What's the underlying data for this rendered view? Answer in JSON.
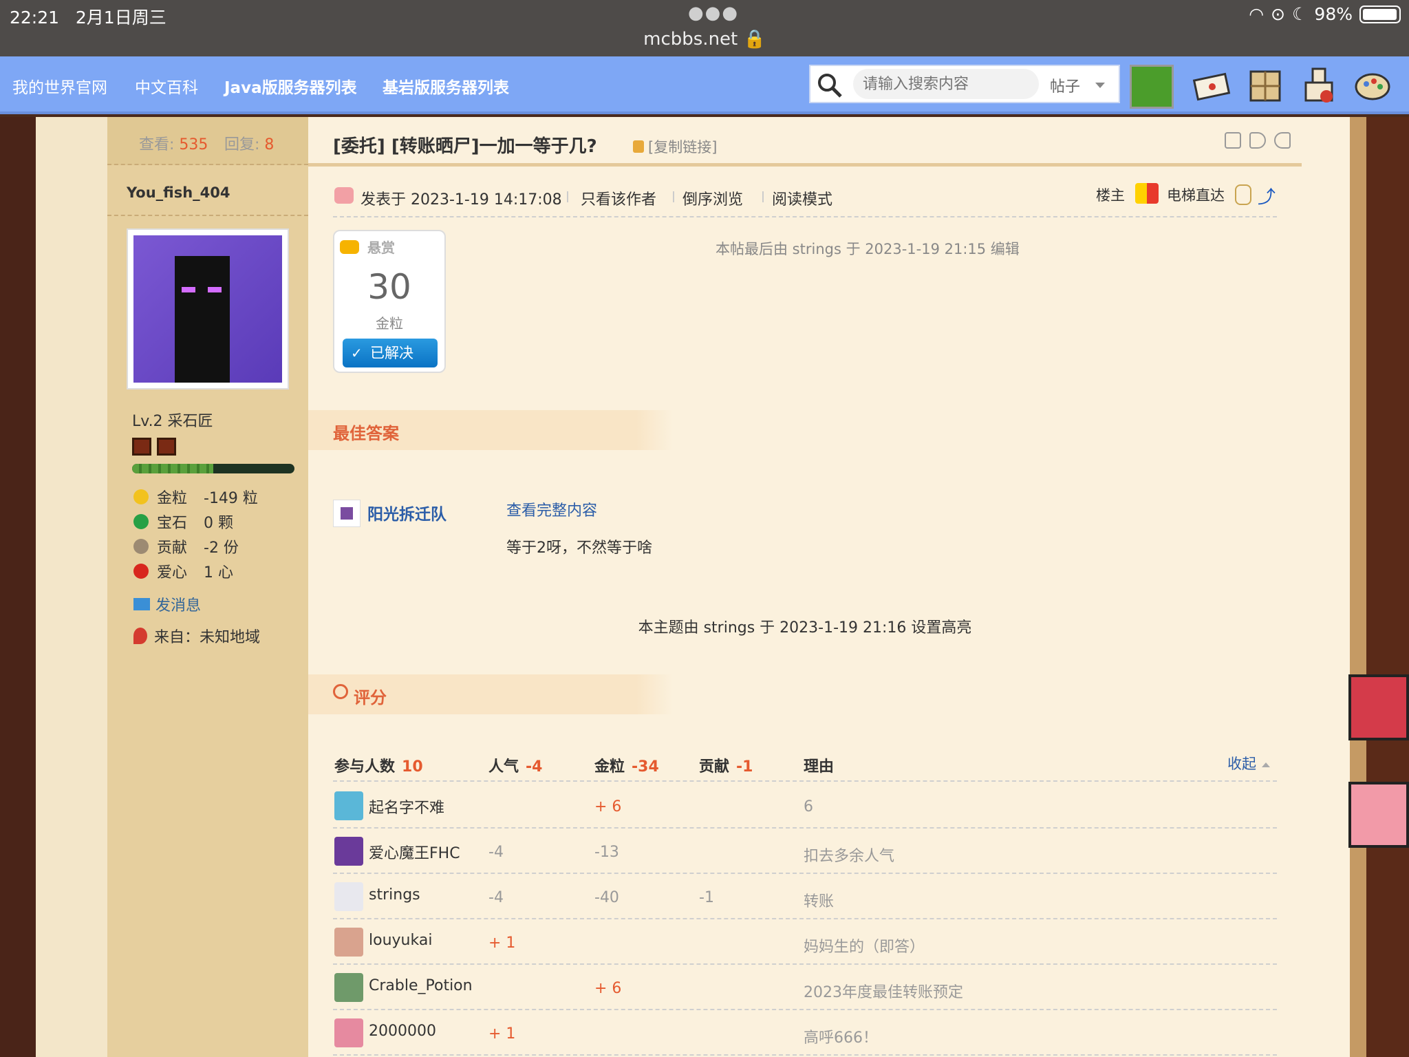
{
  "status": {
    "time": "22:21",
    "date": "2月1日周三",
    "battery": "98%",
    "battery_level": 0.98,
    "url": "mcbbs.net"
  },
  "nav": {
    "links": [
      "我的世界官网",
      "中文百科",
      "Java版服务器列表",
      "基岩版服务器列表"
    ],
    "search_placeholder": "请输入搜索内容",
    "search_type": "帖子"
  },
  "sidebar": {
    "views_label": "查看:",
    "views": "535",
    "replies_label": "回复:",
    "replies": "8",
    "username": "You_fish_404",
    "level": "Lv.2 采石匠",
    "xp_progress": 0.5,
    "stats": [
      {
        "icon": "gold-nugget-icon",
        "label": "金粒",
        "value": "-149 粒",
        "color": "#f2c21e"
      },
      {
        "icon": "emerald-icon",
        "label": "宝石",
        "value": "0 颗",
        "color": "#27a045"
      },
      {
        "icon": "contribution-icon",
        "label": "贡献",
        "value": "-2 份",
        "color": "#9c8a72"
      },
      {
        "icon": "apple-heart-icon",
        "label": "爱心",
        "value": "1 心",
        "color": "#d8271e"
      }
    ],
    "message": "发消息",
    "from": "来自：未知地域"
  },
  "thread": {
    "title": "[委托] [转账晒尸]一加一等于几?",
    "copy_link": "[复制链接]",
    "posted": "发表于 2023-1-19 14:17:08",
    "author_only": "只看该作者",
    "reverse": "倒序浏览",
    "reading_mode": "阅读模式",
    "floor": "楼主",
    "elevator": "电梯直达",
    "edit_note": "本帖最后由 strings 于 2023-1-19 21:15 编辑",
    "bounty": {
      "label": "悬赏",
      "amount": "30",
      "unit": "金粒",
      "status": "已解决"
    },
    "best_answer": {
      "heading": "最佳答案",
      "user": "阳光拆迁队",
      "link": "查看完整内容",
      "text": "等于2呀，不然等于啥"
    },
    "highlight_note": "本主题由 strings 于 2023-1-19 21:16 设置高亮"
  },
  "rating": {
    "heading": "评分",
    "headers": {
      "participants": "参与人数",
      "participants_count": "10",
      "popularity": "人气",
      "popularity_total": "-4",
      "gold": "金粒",
      "gold_total": "-34",
      "contribution": "贡献",
      "contribution_total": "-1",
      "reason": "理由",
      "collapse": "收起"
    },
    "rows": [
      {
        "user": "起名字不难",
        "popularity": "",
        "gold": "+ 6",
        "contribution": "",
        "reason": "6",
        "avatar_color": "#5ab7d8"
      },
      {
        "user": "爱心魔王FHC",
        "popularity": "-4",
        "gold": "-13",
        "contribution": "",
        "reason": "扣去多余人气",
        "avatar_color": "#6a3a9a"
      },
      {
        "user": "strings",
        "popularity": "-4",
        "gold": "-40",
        "contribution": "-1",
        "reason": "转账",
        "avatar_color": "#e8e8ee"
      },
      {
        "user": "louyukai",
        "popularity": "+ 1",
        "gold": "",
        "contribution": "",
        "reason": "妈妈生的（即答）",
        "avatar_color": "#d9a38e"
      },
      {
        "user": "Crable_Potion",
        "popularity": "",
        "gold": "+ 6",
        "contribution": "",
        "reason": "2023年度最佳转账预定",
        "avatar_color": "#6f9a6a"
      },
      {
        "user": "2000000",
        "popularity": "+ 1",
        "gold": "",
        "contribution": "",
        "reason": "高呼666！",
        "avatar_color": "#e68aa0"
      }
    ]
  }
}
